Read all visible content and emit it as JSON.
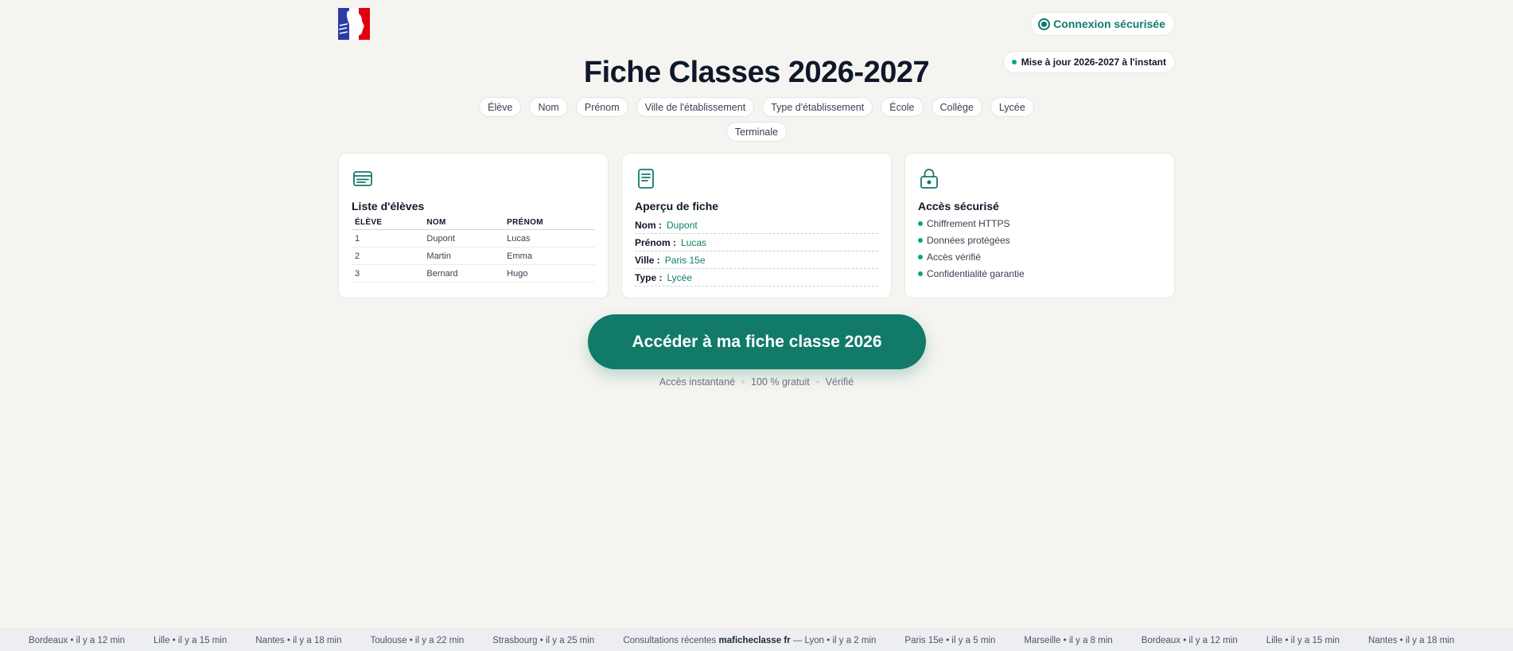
{
  "header": {
    "secure_label": "Connexion sécurisée",
    "update_label": "Mise à jour 2026-2027 à l'instant"
  },
  "page_title": "Fiche Classes 2026-2027",
  "tags": [
    "Élève",
    "Nom",
    "Prénom",
    "Ville de l'établissement",
    "Type d'établissement",
    "École",
    "Collège",
    "Lycée",
    "Terminale"
  ],
  "cards": {
    "students": {
      "icon": "card-list-icon",
      "title": "Liste d'élèves",
      "columns": [
        "ÉLÈVE",
        "NOM",
        "PRÉNOM"
      ],
      "rows": [
        [
          "1",
          "Dupont",
          "Lucas"
        ],
        [
          "2",
          "Martin",
          "Emma"
        ],
        [
          "3",
          "Bernard",
          "Hugo"
        ]
      ]
    },
    "preview": {
      "icon": "document-icon",
      "title": "Aperçu de fiche",
      "fields": [
        {
          "label": "Nom :",
          "value": "Dupont"
        },
        {
          "label": "Prénom :",
          "value": "Lucas"
        },
        {
          "label": "Ville :",
          "value": "Paris 15e"
        },
        {
          "label": "Type :",
          "value": "Lycée"
        }
      ]
    },
    "security": {
      "icon": "lock-icon",
      "title": "Accès sécurisé",
      "items": [
        "Chiffrement HTTPS",
        "Données protégées",
        "Accès vérifié",
        "Confidentialité garantie"
      ]
    }
  },
  "cta": {
    "label": "Accéder à ma fiche classe 2026",
    "sub": [
      "Accès instantané",
      "100 % gratuit",
      "Vérifié"
    ]
  },
  "ticker": {
    "items": [
      "Bordeaux • il y a 12 min",
      "Lille • il y a 15 min",
      "Nantes • il y a 18 min",
      "Toulouse • il y a 22 min",
      "Strasbourg • il y a 25 min",
      "Consultations récentes ",
      "Paris 15e • il y a 5 min",
      "Marseille • il y a 8 min",
      "Bordeaux • il y a 12 min",
      "Lille • il y a 15 min",
      "Nantes • il y a 18 min"
    ],
    "brand": "maficheclasse fr",
    "brand_suffix": " — Lyon • il y a 2 min"
  },
  "colors": {
    "accent": "#117a69",
    "background": "#f5f4f0"
  }
}
